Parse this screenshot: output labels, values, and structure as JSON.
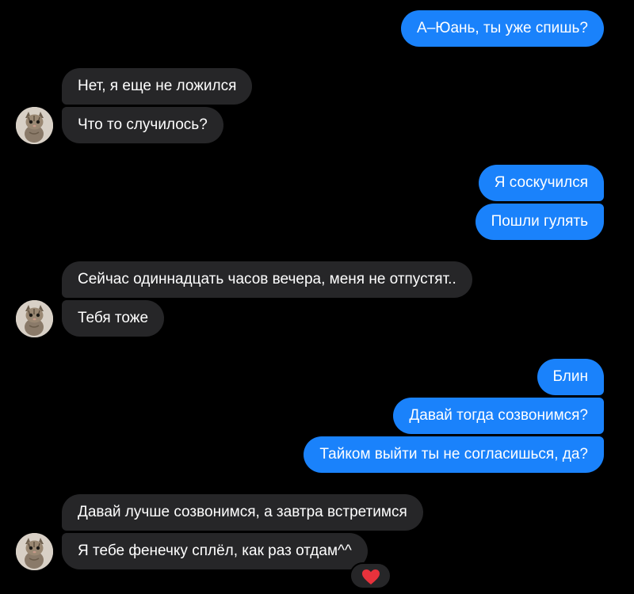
{
  "colors": {
    "background": "#000000",
    "outgoing_bubble": "#1a82fb",
    "incoming_bubble": "#262628",
    "text": "#ffffff",
    "reaction_heart": "#e8323c"
  },
  "messages": [
    {
      "sender": "me",
      "text": "А–Юань, ты уже спишь?"
    },
    {
      "sender": "them",
      "text": "Нет, я еще не ложился"
    },
    {
      "sender": "them",
      "text": "Что то случилось?"
    },
    {
      "sender": "me",
      "text": "Я соскучился"
    },
    {
      "sender": "me",
      "text": "Пошли гулять"
    },
    {
      "sender": "them",
      "text": "Сейчас одиннадцать часов вечера, меня не отпустят.."
    },
    {
      "sender": "them",
      "text": "Тебя тоже"
    },
    {
      "sender": "me",
      "text": "Блин"
    },
    {
      "sender": "me",
      "text": "Давай тогда созвонимся?"
    },
    {
      "sender": "me",
      "text": "Тайком выйти ты не согласишься, да?"
    },
    {
      "sender": "them",
      "text": "Давай лучше созвонимся, а завтра встретимся"
    },
    {
      "sender": "them",
      "text": "Я тебе фенечку сплёл, как раз отдам^^",
      "reaction": "heart-icon"
    }
  ],
  "contact": {
    "avatar": "cat-avatar"
  }
}
